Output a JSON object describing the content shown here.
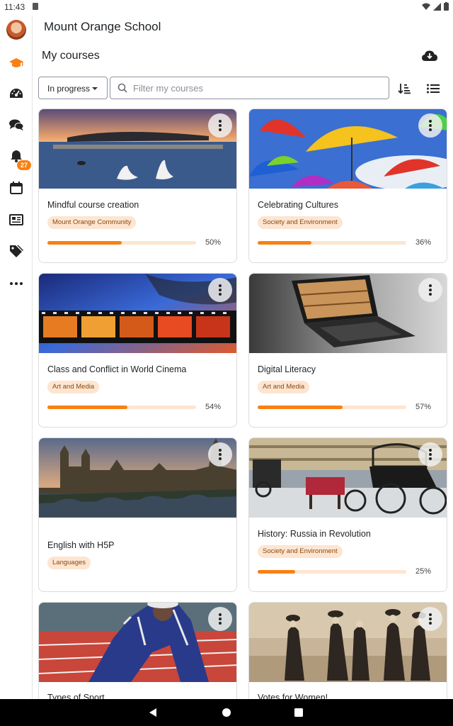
{
  "status_bar": {
    "time": "11:43"
  },
  "sidebar": {
    "items": [
      {
        "icon": "avatar"
      },
      {
        "icon": "graduation-cap-icon",
        "active": true
      },
      {
        "icon": "dashboard-gauge-icon"
      },
      {
        "icon": "messages-icon"
      },
      {
        "icon": "notifications-bell-icon",
        "badge": "27"
      },
      {
        "icon": "calendar-icon"
      },
      {
        "icon": "news-icon"
      },
      {
        "icon": "tags-icon"
      },
      {
        "icon": "more-icon"
      }
    ]
  },
  "header": {
    "site_name": "Mount Orange School"
  },
  "page": {
    "title": "My courses",
    "filter_value": "In progress",
    "search_placeholder": "Filter my courses"
  },
  "colors": {
    "accent": "#f98012",
    "tag_bg": "#fde5d1",
    "tag_text": "#8a4a14"
  },
  "courses": [
    {
      "title": "Mindful course creation",
      "category": "Mount Orange Community",
      "progress": 50,
      "progress_label": "50%",
      "image": "lake-swans-sunset"
    },
    {
      "title": "Celebrating Cultures",
      "category": "Society and Environment",
      "progress": 36,
      "progress_label": "36%",
      "image": "colorful-umbrellas"
    },
    {
      "title": "Class and Conflict in World Cinema",
      "category": "Art and Media",
      "progress": 54,
      "progress_label": "54%",
      "image": "film-strip"
    },
    {
      "title": "Digital Literacy",
      "category": "Art and Media",
      "progress": 57,
      "progress_label": "57%",
      "image": "laptop-bookshelf"
    },
    {
      "title": "English with H5P",
      "category": "Languages",
      "image": "london-parliament"
    },
    {
      "title": "History: Russia in Revolution",
      "category": "Society and Environment",
      "progress": 25,
      "progress_label": "25%",
      "image": "horse-carriages"
    },
    {
      "title": "Types of Sport",
      "image": "runner-track"
    },
    {
      "title": "Votes for Women!",
      "image": "suffragettes-photo"
    }
  ]
}
